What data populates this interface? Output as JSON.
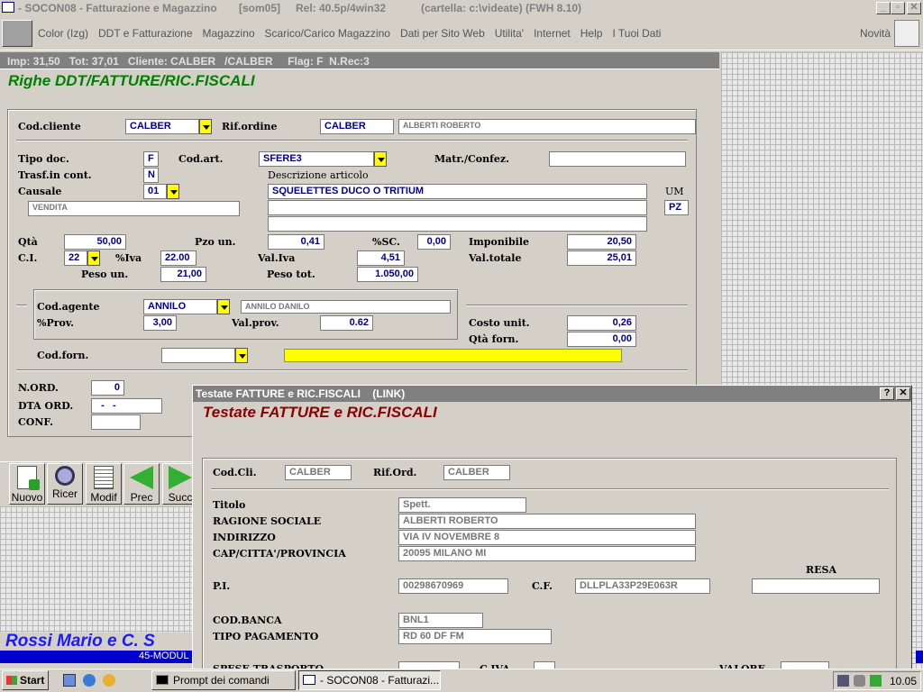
{
  "window": {
    "title": "- SOCON08 - Fatturazione e Magazzino",
    "user": "[som05]",
    "rel": "Rel: 40.5p/4win32",
    "folder": "(cartella: c:\\videate) (FWH 8.10)"
  },
  "menu": [
    "Color (Izg)",
    "DDT e Fatturazione",
    "Magazzino",
    "Scarico/Carico Magazzino",
    "Dati per Sito Web",
    "Utilita'",
    "Internet",
    "Help",
    "I Tuoi Dati"
  ],
  "menu_right": "Novità",
  "status": {
    "text": "Imp: 31,50   Tot: 37,01   Cliente: CALBER   /CALBER     Flag: F  N.Rec:3"
  },
  "main": {
    "title": "Righe DDT/FATTURE/RIC.FISCALI",
    "cod_cliente_label": "Cod.cliente",
    "cod_cliente": "CALBER",
    "rif_ordine_label": "Rif.ordine",
    "rif_ordine": "CALBER",
    "cliente_nome": "ALBERTI ROBERTO",
    "tipo_doc_label": "Tipo doc.",
    "tipo_doc": "F",
    "cod_art_label": "Cod.art.",
    "cod_art": "SFERE3",
    "matr_label": "Matr./Confez.",
    "matr": "",
    "trasf_label": "Trasf.in cont.",
    "trasf": "N",
    "descr_label": "Descrizione articolo",
    "causale_label": "Causale",
    "causale": "01",
    "descr1": "SQUELETTES DUCO O TRITIUM",
    "descr2": "",
    "descr3": "",
    "um_label": "UM",
    "um": "PZ",
    "vendita": "VENDITA",
    "qta_label": "Qtà",
    "qta": "50,00",
    "pzo_label": "Pzo un.",
    "pzo": "0,41",
    "sc_label": "%SC.",
    "sc": "0,00",
    "imponibile_label": "Imponibile",
    "imponibile": "20,50",
    "ci_label": "C.I.",
    "ci": "22",
    "iva_label": "%Iva",
    "iva": "22.00",
    "val_iva_label": "Val.Iva",
    "val_iva": "4,51",
    "val_tot_label": "Val.totale",
    "val_tot": "25,01",
    "peso_un_label": "Peso un.",
    "peso_un": "21,00",
    "peso_tot_label": "Peso tot.",
    "peso_tot": "1.050,00",
    "agente_label": "Cod.agente",
    "agente": "ANNILO",
    "agente_nome": "ANNILO DANILO",
    "prov_label": "%Prov.",
    "prov": "3,00",
    "valprov_label": "Val.prov.",
    "valprov": "0.62",
    "costo_label": "Costo unit.",
    "costo": "0,26",
    "qta_forn_label": "Qtà forn.",
    "qta_forn": "0,00",
    "forn_label": "Cod.forn.",
    "forn": "",
    "nord_label": "N.ORD.",
    "nord": "0",
    "dta_label": "DTA ORD.",
    "dta": "  -   -",
    "conf_label": "CONF.",
    "conf": ""
  },
  "toolbar": [
    {
      "label": "Nuovo",
      "icon": "new-doc-icon"
    },
    {
      "label": "Ricer",
      "icon": "magnifier-icon"
    },
    {
      "label": "Modif",
      "icon": "edit-doc-icon"
    },
    {
      "label": "Prec",
      "icon": "arrow-left-icon"
    },
    {
      "label": "Succ",
      "icon": "arrow-right-icon"
    }
  ],
  "company": {
    "name": "Rossi Mario e C. S",
    "sub": "45-MODUL"
  },
  "dialog": {
    "title": "Testate FATTURE e RIC.FISCALI    (LINK)",
    "heading": "Testate FATTURE e RIC.FISCALI",
    "codcli_label": "Cod.Cli.",
    "codcli": "CALBER",
    "riford_label": "Rif.Ord.",
    "riford": "CALBER",
    "titolo_label": "Titolo",
    "titolo": "Spett.",
    "ragione_label": "RAGIONE SOCIALE",
    "ragione": "ALBERTI ROBERTO",
    "indirizzo_label": "INDIRIZZO",
    "indirizzo": "VIA IV NOVEMBRE 8",
    "cap_label": "CAP/CITTA'/PROVINCIA",
    "cap": "20095 MILANO MI",
    "resa_label": "RESA",
    "resa": "",
    "pi_label": "P.I.",
    "pi": "00298670969",
    "cf_label": "C.F.",
    "cf": "DLLPLA33P29E063R",
    "banca_label": "COD.BANCA",
    "banca": "BNL1",
    "pagamento_label": "TIPO PAGAMENTO",
    "pagamento": "RD 60 DF FM",
    "spese_label": "SPESE TRASPORTO",
    "civa_label": "C.IVA",
    "valore_label": "VALORE"
  },
  "taskbar": {
    "start": "Start",
    "tasks": [
      "Prompt dei comandi",
      "- SOCON08 - Fatturazi..."
    ],
    "clock": "10.05"
  },
  "colors": {
    "title_green": "#008000",
    "title_red": "#8b0000",
    "company_blue": "#1a1aff",
    "titlebar": "#0a246a",
    "yellow": "#ffff00"
  }
}
